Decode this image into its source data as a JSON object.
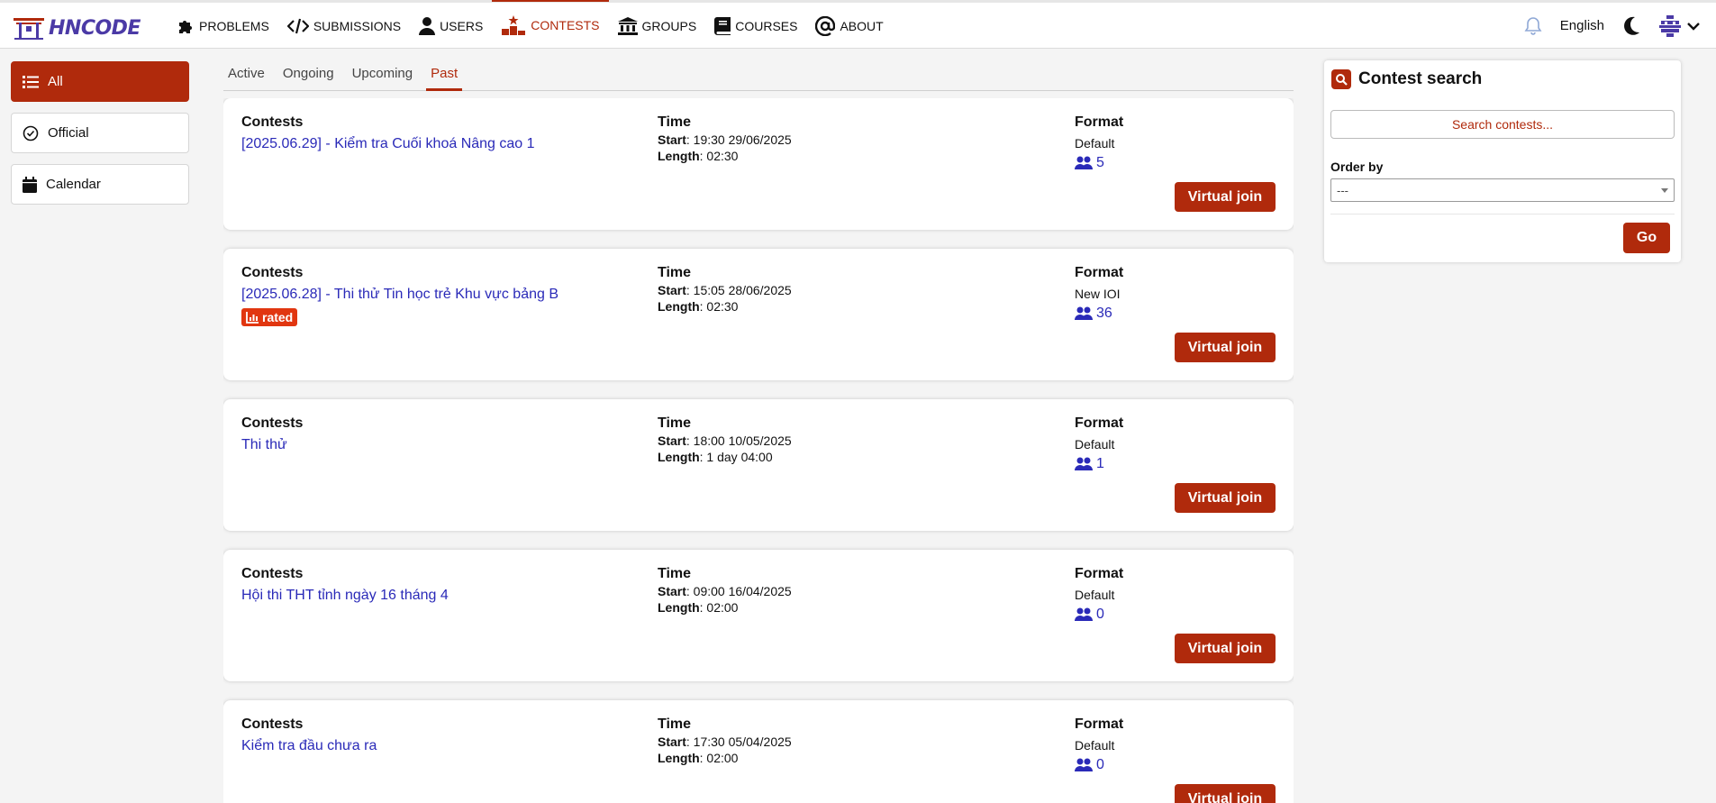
{
  "brand": {
    "logo_text": "HNCODE"
  },
  "nav": [
    {
      "label": "PROBLEMS",
      "icon": "puzzle-icon"
    },
    {
      "label": "SUBMISSIONS",
      "icon": "code-icon"
    },
    {
      "label": "USERS",
      "icon": "user-icon"
    },
    {
      "label": "CONTESTS",
      "icon": "podium-icon",
      "active": true
    },
    {
      "label": "GROUPS",
      "icon": "institution-icon"
    },
    {
      "label": "COURSES",
      "icon": "book-icon"
    },
    {
      "label": "ABOUT",
      "icon": "at-icon"
    }
  ],
  "header_right": {
    "language": "English"
  },
  "sidebar": {
    "items": [
      {
        "label": "All",
        "active": true
      },
      {
        "label": "Official"
      },
      {
        "label": "Calendar"
      }
    ]
  },
  "tabs": [
    {
      "label": "Active"
    },
    {
      "label": "Ongoing"
    },
    {
      "label": "Upcoming"
    },
    {
      "label": "Past",
      "active": true
    }
  ],
  "columns": {
    "contests": "Contests",
    "time": "Time",
    "format": "Format"
  },
  "labels": {
    "start": "Start",
    "length": "Length",
    "virtual_join": "Virtual join",
    "rated": "rated"
  },
  "contests": [
    {
      "name": "[2025.06.29] - Kiểm tra Cuối khoá Nâng cao 1",
      "start": ": 19:30 29/06/2025",
      "length": ": 02:30",
      "format": "Default",
      "users": "5",
      "rated": false
    },
    {
      "name": "[2025.06.28] - Thi thử Tin học trẻ Khu vực bảng B",
      "start": ": 15:05 28/06/2025",
      "length": ": 02:30",
      "format": "New IOI",
      "users": "36",
      "rated": true
    },
    {
      "name": "Thi thử",
      "start": ": 18:00 10/05/2025",
      "length": ": 1 day 04:00",
      "format": "Default",
      "users": "1",
      "rated": false
    },
    {
      "name": "Hội thi THT tỉnh ngày 16 tháng 4",
      "start": ": 09:00 16/04/2025",
      "length": ": 02:00",
      "format": "Default",
      "users": "0",
      "rated": false
    },
    {
      "name": "Kiểm tra đầu chưa ra",
      "start": ": 17:30 05/04/2025",
      "length": ": 02:00",
      "format": "Default",
      "users": "0",
      "rated": false
    }
  ],
  "search_panel": {
    "title": "Contest search",
    "search_placeholder": "Search contests...",
    "order_by_label": "Order by",
    "order_by_value": "---",
    "go_label": "Go"
  },
  "colors": {
    "accent": "#b02a0c",
    "link": "#2a2ab8",
    "rated_badge": "#e13610"
  }
}
